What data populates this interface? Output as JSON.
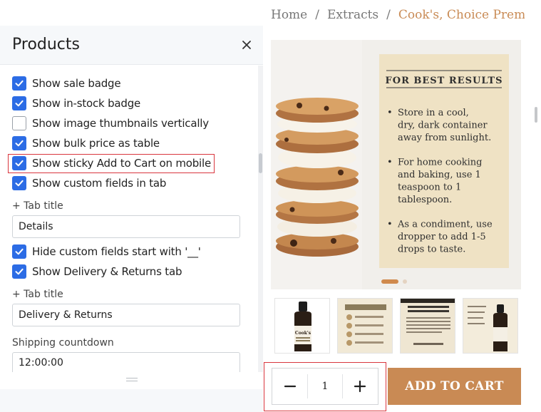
{
  "panel": {
    "title": "Products",
    "close_icon": "close-icon",
    "checkboxes": [
      {
        "label": "Show sale badge",
        "checked": true
      },
      {
        "label": "Show in-stock badge",
        "checked": true
      },
      {
        "label": "Show image thumbnails vertically",
        "checked": false
      },
      {
        "label": "Show bulk price as table",
        "checked": true
      },
      {
        "label": "Show sticky Add to Cart on mobile",
        "checked": true
      },
      {
        "label": "Show custom fields in tab",
        "checked": true
      }
    ],
    "tab_title_1": {
      "label": "+ Tab title",
      "value": "Details"
    },
    "checkboxes_2": [
      {
        "label": "Hide custom fields start with '__'",
        "checked": true
      },
      {
        "label": "Show Delivery & Returns tab",
        "checked": true
      }
    ],
    "tab_title_2": {
      "label": "+ Tab title",
      "value": "Delivery & Returns"
    },
    "shipping": {
      "label": "Shipping countdown",
      "value": "12:00:00"
    }
  },
  "preview": {
    "breadcrumb": [
      {
        "label": "Home"
      },
      {
        "label": "Extracts"
      },
      {
        "label": "Cook's, Choice Premium"
      }
    ],
    "breadcrumb_separator": "/",
    "gallery": {
      "card_heading": "FOR BEST RESULTS",
      "tips": [
        [
          "Store in a cool,",
          "dry, dark container",
          "away from sunlight."
        ],
        [
          "For home cooking",
          "and baking, use 1",
          "teaspoon to 1",
          "tablespoon."
        ],
        [
          "As a condiment, use",
          "dropper to add 1-5",
          "drops to taste."
        ]
      ],
      "slide_count": 2,
      "active_slide": 1
    },
    "quantity": "1",
    "add_to_cart_label": "ADD TO CART",
    "colors": {
      "accent": "#c98a54",
      "checkbox_blue": "#2c6ce5",
      "highlight_red": "#d9363e"
    }
  }
}
